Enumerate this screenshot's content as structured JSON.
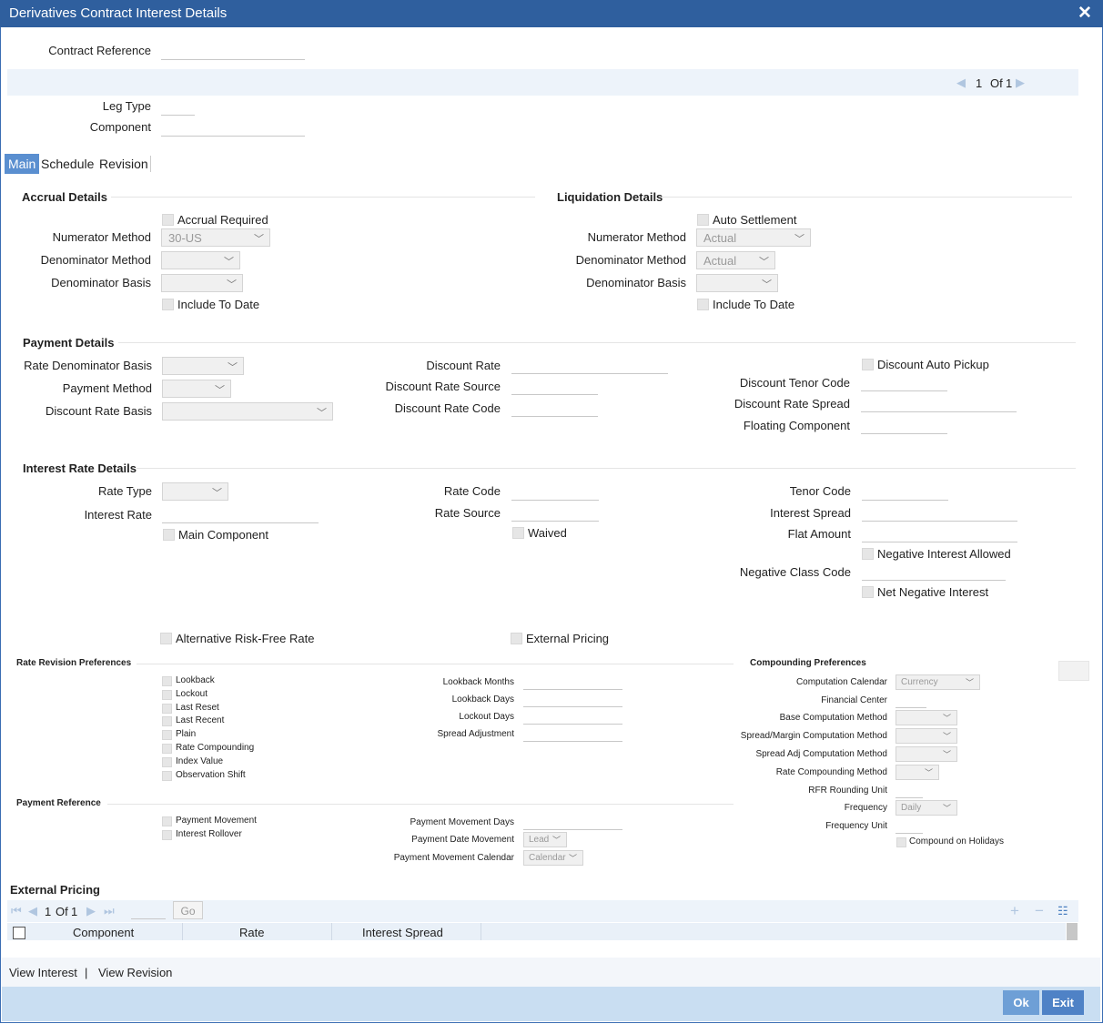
{
  "window": {
    "title": "Derivatives Contract Interest Details",
    "close_icon": "close-icon"
  },
  "header": {
    "contract_reference_label": "Contract Reference",
    "leg_type_label": "Leg Type",
    "component_label": "Component",
    "pager": {
      "current": "1",
      "of_label": "Of",
      "total": "1"
    }
  },
  "tabs": [
    {
      "label": "Main"
    },
    {
      "label": "Schedule"
    },
    {
      "label": "Revision"
    }
  ],
  "accrual": {
    "title": "Accrual Details",
    "accrual_required": "Accrual Required",
    "numerator_method_label": "Numerator Method",
    "numerator_method_value": "30-US",
    "denominator_method_label": "Denominator Method",
    "denominator_method_value": "",
    "denominator_basis_label": "Denominator Basis",
    "denominator_basis_value": "",
    "include_to_date": "Include To Date"
  },
  "liquidation": {
    "title": "Liquidation Details",
    "auto_settlement": "Auto Settlement",
    "numerator_method_label": "Numerator Method",
    "numerator_method_value": "Actual",
    "denominator_method_label": "Denominator Method",
    "denominator_method_value": "Actual",
    "denominator_basis_label": "Denominator Basis",
    "denominator_basis_value": "",
    "include_to_date": "Include To Date"
  },
  "payment": {
    "title": "Payment Details",
    "rate_denominator_basis": "Rate Denominator Basis",
    "payment_method": "Payment Method",
    "discount_rate_basis": "Discount Rate Basis",
    "discount_rate": "Discount Rate",
    "discount_rate_source": "Discount Rate Source",
    "discount_rate_code": "Discount Rate Code",
    "discount_auto_pickup": "Discount Auto Pickup",
    "discount_tenor_code": "Discount Tenor Code",
    "discount_rate_spread": "Discount Rate Spread",
    "floating_component": "Floating Component"
  },
  "interest": {
    "title": "Interest Rate Details",
    "rate_type": "Rate Type",
    "interest_rate": "Interest Rate",
    "main_component": "Main Component",
    "rate_code": "Rate Code",
    "rate_source": "Rate Source",
    "waived": "Waived",
    "tenor_code": "Tenor Code",
    "interest_spread": "Interest Spread",
    "flat_amount": "Flat Amount",
    "negative_interest_allowed": "Negative Interest Allowed",
    "negative_class_code": "Negative Class Code",
    "net_negative_interest": "Net Negative Interest"
  },
  "alt_risk_free_rate": "Alternative Risk-Free Rate",
  "external_pricing_cb": "External Pricing",
  "rate_revision": {
    "title": "Rate Revision Preferences",
    "options": [
      "Lookback",
      "Lockout",
      "Last Reset",
      "Last Recent",
      "Plain",
      "Rate Compounding",
      "Index Value",
      "Observation Shift"
    ],
    "lookback_months": "Lookback Months",
    "lookback_days": "Lookback Days",
    "lockout_days": "Lockout Days",
    "spread_adjustment": "Spread Adjustment"
  },
  "compounding": {
    "title": "Compounding Preferences",
    "computation_calendar": "Computation Calendar",
    "computation_calendar_value": "Currency",
    "financial_center": "Financial Center",
    "base_computation_method": "Base Computation Method",
    "spread_margin_computation_method": "Spread/Margin Computation Method",
    "spread_adj_computation_method": "Spread Adj Computation Method",
    "rate_compounding_method": "Rate Compounding Method",
    "rfr_rounding_unit": "RFR Rounding Unit",
    "frequency": "Frequency",
    "frequency_value": "Daily",
    "frequency_unit": "Frequency Unit",
    "compound_on_holidays": "Compound on Holidays"
  },
  "payment_reference": {
    "title": "Payment Reference",
    "payment_movement": "Payment Movement",
    "interest_rollover": "Interest Rollover",
    "payment_movement_days": "Payment Movement Days",
    "payment_date_movement": "Payment Date Movement",
    "payment_date_movement_value": "Lead",
    "payment_movement_calendar": "Payment Movement Calendar",
    "payment_movement_calendar_value": "Calendar"
  },
  "external_pricing": {
    "title": "External Pricing",
    "pager": {
      "current": "1",
      "of_label": "Of",
      "total": "1",
      "go_label": "Go"
    },
    "columns": [
      "Component",
      "Rate",
      "Interest Spread"
    ]
  },
  "footer": {
    "view_interest": "View Interest",
    "separator": "|",
    "view_revision": "View Revision",
    "ok": "Ok",
    "exit": "Exit"
  }
}
